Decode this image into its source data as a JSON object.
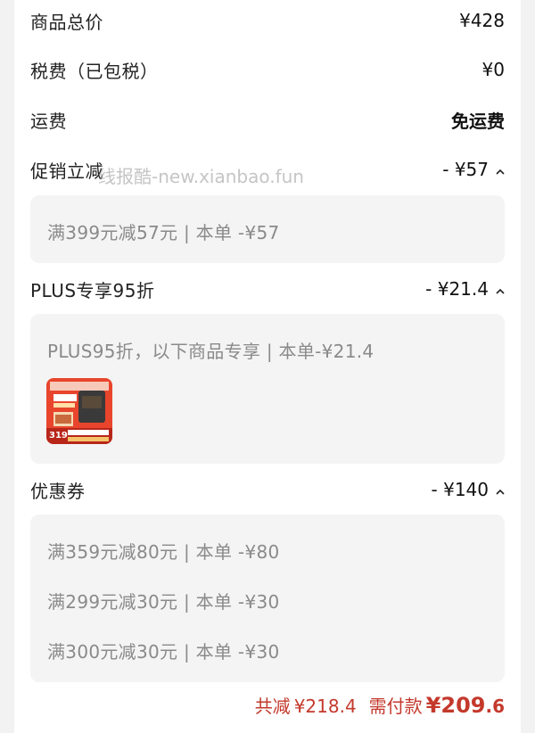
{
  "summary": {
    "goods_total": {
      "label": "商品总价",
      "value": "¥428"
    },
    "tax": {
      "label": "税费（已包税）",
      "value": "¥0"
    },
    "shipping": {
      "label": "运费",
      "value": "免运费"
    }
  },
  "promo": {
    "label": "促销立减",
    "value": "- ¥57",
    "details": [
      "满399元减57元 | 本单 -¥57"
    ]
  },
  "plus": {
    "label": "PLUS专享95折",
    "value": "- ¥21.4",
    "details": [
      "PLUS95折，以下商品专享 | 本单-¥21.4"
    ],
    "product_price": "319"
  },
  "coupon": {
    "label": "优惠券",
    "value": "- ¥140",
    "details": [
      "满359元减80元 | 本单 -¥80",
      "满299元减30元 | 本单 -¥30",
      "满300元减30元 | 本单 -¥30"
    ]
  },
  "footer": {
    "total_reduce_label": "共减",
    "total_reduce_value": "¥218.4",
    "pay_label": "需付款",
    "pay_currency": "¥",
    "pay_integer": "209",
    "pay_fraction": ".6"
  },
  "watermark": "线报酷-new.xianbao.fun",
  "colors": {
    "accent": "#c4392c",
    "muted_text": "#8a8a8a",
    "box_bg": "#f4f4f4"
  }
}
